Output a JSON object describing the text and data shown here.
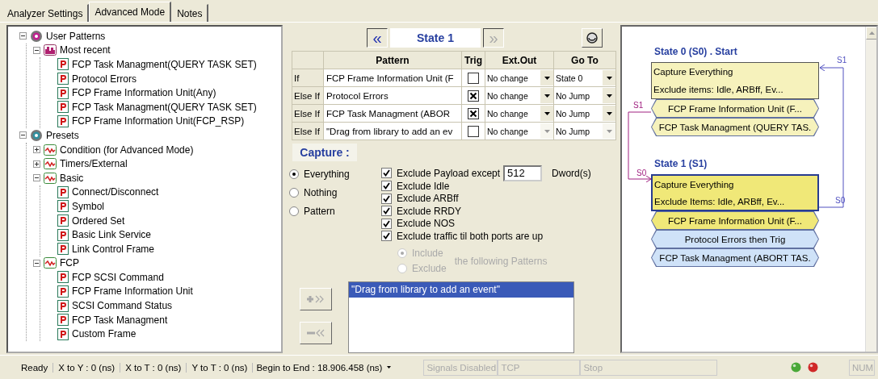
{
  "tabs": [
    {
      "label": "Analyzer Settings",
      "selected": false
    },
    {
      "label": "Advanced Mode",
      "selected": true
    },
    {
      "label": "Notes",
      "selected": false
    }
  ],
  "tree": [
    {
      "label": "User Patterns",
      "kind": "user",
      "expanded": true,
      "children": [
        {
          "label": "Most recent",
          "kind": "recent",
          "expanded": true,
          "children": [
            {
              "label": "FCP Task Managment(QUERY TASK SET)",
              "kind": "pattern"
            },
            {
              "label": "Protocol Errors",
              "kind": "pattern"
            },
            {
              "label": "FCP Frame Information Unit(Any)",
              "kind": "pattern"
            },
            {
              "label": "FCP Task Managment(QUERY TASK SET)",
              "kind": "pattern"
            },
            {
              "label": "FCP Frame Information Unit(FCP_RSP)",
              "kind": "pattern"
            }
          ]
        }
      ]
    },
    {
      "label": "Presets",
      "kind": "presets",
      "expanded": true,
      "children": [
        {
          "label": "Condition (for Advanced Mode)",
          "kind": "folder",
          "expanded": false
        },
        {
          "label": "Timers/External",
          "kind": "folder",
          "expanded": false
        },
        {
          "label": "Basic",
          "kind": "folder",
          "expanded": true,
          "children": [
            {
              "label": "Connect/Disconnect",
              "kind": "pattern"
            },
            {
              "label": "Symbol",
              "kind": "pattern"
            },
            {
              "label": "Ordered Set",
              "kind": "pattern"
            },
            {
              "label": "Basic Link Service",
              "kind": "pattern"
            },
            {
              "label": "Link Control Frame",
              "kind": "pattern"
            }
          ]
        },
        {
          "label": "FCP",
          "kind": "folder",
          "expanded": true,
          "children": [
            {
              "label": "FCP SCSI Command",
              "kind": "pattern"
            },
            {
              "label": "FCP Frame Information Unit",
              "kind": "pattern"
            },
            {
              "label": "SCSI Command Status",
              "kind": "pattern"
            },
            {
              "label": "FCP Task Managment",
              "kind": "pattern"
            },
            {
              "label": "Custom Frame",
              "kind": "pattern"
            }
          ]
        }
      ]
    }
  ],
  "state_nav": {
    "prev": {
      "label": "«",
      "disabled": false
    },
    "title": "State 1",
    "next": {
      "label": "»",
      "disabled": true
    }
  },
  "table": {
    "columns": [
      "Pattern",
      "Trig",
      "Ext.Out",
      "Go To"
    ],
    "rows": [
      {
        "condition": "If",
        "pattern": "FCP Frame Information Unit (F",
        "trig": false,
        "ext_out": "No change",
        "go_to": "State 0",
        "disabled": false
      },
      {
        "condition": "Else If",
        "pattern": "Protocol Errors",
        "trig": true,
        "ext_out": "No change",
        "go_to": "No Jump",
        "disabled": false
      },
      {
        "condition": "Else If",
        "pattern": "FCP Task Managment (ABOR",
        "trig": true,
        "ext_out": "No change",
        "go_to": "No Jump",
        "disabled": false
      },
      {
        "condition": "Else If",
        "pattern": "\"Drag from library to add an ev",
        "trig": false,
        "ext_out": "No change",
        "go_to": "No Jump",
        "disabled": true
      }
    ]
  },
  "capture": {
    "title": "Capture :",
    "modes": [
      {
        "label": "Everything",
        "selected": true
      },
      {
        "label": "Nothing",
        "selected": false
      },
      {
        "label": "Pattern",
        "selected": false
      }
    ],
    "options": [
      {
        "label": "Exclude Payload except",
        "checked": true
      },
      {
        "label": "Exclude Idle",
        "checked": true
      },
      {
        "label": "Exclude ARBff",
        "checked": true
      },
      {
        "label": "Exclude RRDY",
        "checked": true
      },
      {
        "label": "Exclude NOS",
        "checked": true
      },
      {
        "label": "Exclude traffic til both ports are up",
        "checked": true
      }
    ],
    "payload_value": "512",
    "payload_unit": "Dword(s)",
    "filter": {
      "disabled": true,
      "modes": [
        {
          "label": "Include",
          "selected": true
        },
        {
          "label": "Exclude",
          "selected": false
        }
      ],
      "note": "the following Patterns"
    },
    "buttons": [
      {
        "kind": "add",
        "disabled": true
      },
      {
        "kind": "remove",
        "disabled": true
      }
    ],
    "events": [
      {
        "text": "\"Drag from library to add an event\"",
        "selected": true
      }
    ]
  },
  "diagram": {
    "states": [
      {
        "title": "State 0 (S0) . Start",
        "selected": false,
        "lines": [
          "Capture Everything",
          "Exclude items: Idle, ARBff, Ev..."
        ],
        "patterns": [
          {
            "label": "FCP Frame Information Unit (F...",
            "trig": false
          },
          {
            "label": "FCP Task Managment (QUERY TAS.",
            "trig": false
          }
        ]
      },
      {
        "title": "State 1 (S1)",
        "selected": true,
        "lines": [
          "Capture Everything",
          "Exclude Items: Idle, ARBff, Ev..."
        ],
        "patterns": [
          {
            "label": "FCP Frame Information Unit (F...",
            "trig": false
          },
          {
            "label": "Protocol Errors then Trig",
            "trig": true
          },
          {
            "label": "FCP Task Managment (ABORT TAS.",
            "trig": true
          }
        ]
      }
    ],
    "transitions": [
      {
        "from_label": "S1",
        "to_label": "S0"
      },
      {
        "from_label": "S1",
        "to_label": "S0"
      }
    ]
  },
  "status_bar": {
    "fields": [
      {
        "text": "Ready"
      },
      {
        "text": "X to Y : 0 (ns)"
      },
      {
        "text": "X to T : 0 (ns)"
      },
      {
        "text": "Y to T : 0 (ns)"
      },
      {
        "text": "Begin to End : 18.906.458 (ns)"
      }
    ],
    "panels": [
      {
        "text": "Signals Disabled",
        "disabled": true
      },
      {
        "text": "TCP",
        "disabled": true
      },
      {
        "text": "Stop",
        "disabled": true
      }
    ],
    "lights": [
      {
        "kind": "ok"
      },
      {
        "kind": "stop"
      }
    ],
    "num": {
      "text": "NUM",
      "disabled": true
    }
  }
}
